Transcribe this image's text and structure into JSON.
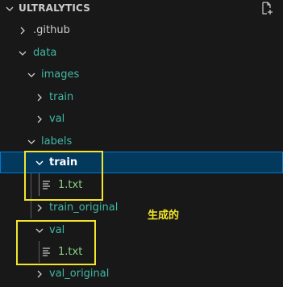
{
  "explorer": {
    "title": "ULTRALYTICS",
    "new_file_icon": "new-file-icon"
  },
  "tree": {
    "github": ".github",
    "data": "data",
    "images": "images",
    "images_train": "train",
    "images_val": "val",
    "labels": "labels",
    "labels_train": "train",
    "labels_train_file": "1.txt",
    "train_original": "train_original",
    "labels_val": "val",
    "labels_val_file": "1.txt",
    "val_original": "val_original"
  },
  "annotation": {
    "text": "生成的",
    "color": "#f3e52a"
  },
  "colors": {
    "background": "#181818",
    "folder_text": "#3fb8a6",
    "file_text": "#89d185",
    "selection_bg": "#04395e",
    "selection_border": "#0078d4"
  }
}
